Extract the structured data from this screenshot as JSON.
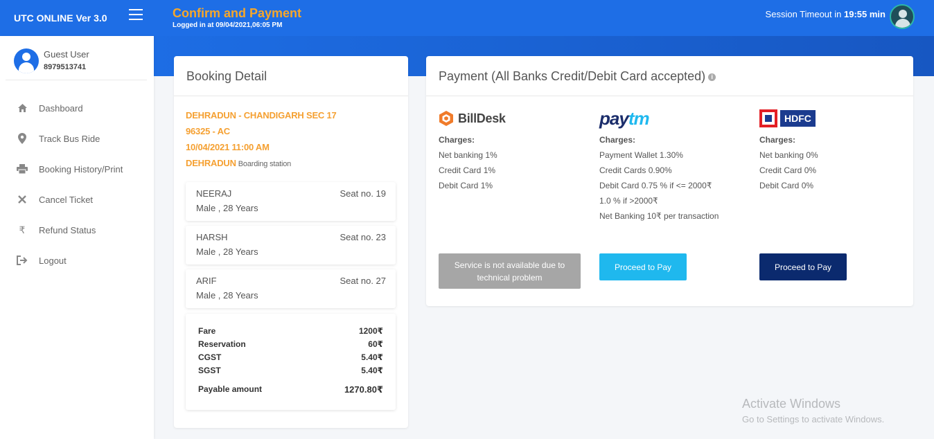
{
  "app": {
    "name": "UTC ONLINE Ver 3.0"
  },
  "header": {
    "title": "Confirm and Payment",
    "logged_in": "Logged in at 09/04/2021,06:05 PM",
    "session_prefix": "Session Timeout in",
    "session_time": "19:55 min"
  },
  "user": {
    "name": "Guest User",
    "phone": "8979513741"
  },
  "sidebar": {
    "items": [
      {
        "label": "Dashboard",
        "icon": "home-icon"
      },
      {
        "label": "Track Bus Ride",
        "icon": "map-pin-icon"
      },
      {
        "label": "Booking History/Print",
        "icon": "printer-icon"
      },
      {
        "label": "Cancel Ticket",
        "icon": "close-icon"
      },
      {
        "label": "Refund Status",
        "icon": "rupee-icon"
      },
      {
        "label": "Logout",
        "icon": "logout-icon"
      }
    ]
  },
  "booking": {
    "title": "Booking Detail",
    "route": "DEHRADUN - CHANDIGARH SEC 17",
    "service": "96325 - AC",
    "datetime": "10/04/2021 11:00 AM",
    "boarding_point": "DEHRADUN",
    "boarding_label": "Boarding station",
    "passengers": [
      {
        "name": "NEERAJ",
        "seat": "Seat no. 19",
        "info": "Male , 28 Years"
      },
      {
        "name": "HARSH",
        "seat": "Seat no. 23",
        "info": "Male , 28 Years"
      },
      {
        "name": "ARIF",
        "seat": "Seat no. 27",
        "info": "Male , 28 Years"
      }
    ],
    "fare": {
      "rows": [
        {
          "label": "Fare",
          "amount": "1200₹"
        },
        {
          "label": "Reservation",
          "amount": "60₹"
        },
        {
          "label": "CGST",
          "amount": "5.40₹"
        },
        {
          "label": "SGST",
          "amount": "5.40₹"
        }
      ],
      "payable_label": "Payable amount",
      "payable_amount": "1270.80₹"
    }
  },
  "payment": {
    "title": "Payment (All Banks Credit/Debit Card accepted)",
    "charges_label": "Charges:",
    "gateways": [
      {
        "logo_text": "BillDesk",
        "lines": [
          "Net banking 1%",
          "Credit Card 1%",
          "Debit Card 1%"
        ],
        "button": "Service is not available due to technical problem",
        "enabled": false
      },
      {
        "logo_text_a": "pay",
        "logo_text_b": "tm",
        "lines": [
          "Payment Wallet 1.30%",
          "Credit Cards 0.90%",
          "Debit Card 0.75 % if <= 2000₹",
          "1.0 % if >2000₹",
          "Net Banking 10₹ per transaction"
        ],
        "button": "Proceed to Pay",
        "enabled": true
      },
      {
        "logo_text": "HDFC",
        "lines": [
          "Net banking 0%",
          "Credit Card 0%",
          "Debit Card 0%"
        ],
        "button": "Proceed to Pay",
        "enabled": true
      }
    ]
  },
  "watermark": {
    "line1": "Activate Windows",
    "line2": "Go to Settings to activate Windows."
  },
  "colors": {
    "primary": "#1e6ee6",
    "accent": "#f7a72a",
    "paytm_button": "#1fb8ee",
    "hdfc_button": "#0b2a6e",
    "disabled": "#a6a6a6"
  }
}
